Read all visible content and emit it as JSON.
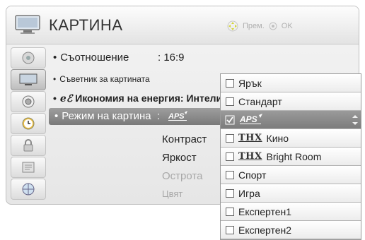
{
  "header": {
    "title": "КАРТИНА",
    "hint_move": "Прем.",
    "hint_ok": "OK"
  },
  "menu": {
    "ratio_label": "Съотношение",
    "ratio_value": ": 16:9",
    "wizard_label": "Съветник за картината",
    "energy_label": "Икономия на енергия: Интелиге",
    "mode_label": "Режим на картина",
    "mode_value_prefix": ":",
    "mode_value_logo": "APS",
    "sub_items": [
      "Контраст",
      "Яркост",
      "Острота",
      "Цвят"
    ]
  },
  "dropdown": {
    "items": [
      {
        "label": "Ярък",
        "logo": "",
        "selected": false
      },
      {
        "label": "Стандарт",
        "logo": "",
        "selected": false
      },
      {
        "label": "",
        "logo": "APS",
        "selected": true
      },
      {
        "label": "Кино",
        "logo": "THX",
        "selected": false
      },
      {
        "label": "Bright Room",
        "logo": "THX",
        "selected": false
      },
      {
        "label": "Спорт",
        "logo": "",
        "selected": false
      },
      {
        "label": "Игра",
        "logo": "",
        "selected": false
      },
      {
        "label": "Експертен1",
        "logo": "",
        "selected": false
      },
      {
        "label": "Експертен2",
        "logo": "",
        "selected": false
      }
    ]
  },
  "sidebar": {
    "icons": [
      "picture-icon",
      "tv-icon",
      "audio-icon",
      "clock-icon",
      "lock-icon",
      "option-icon",
      "network-icon"
    ],
    "active_index": 1
  },
  "colors": {
    "selection": "#8a8a8a",
    "panel": "#eeeeee"
  }
}
